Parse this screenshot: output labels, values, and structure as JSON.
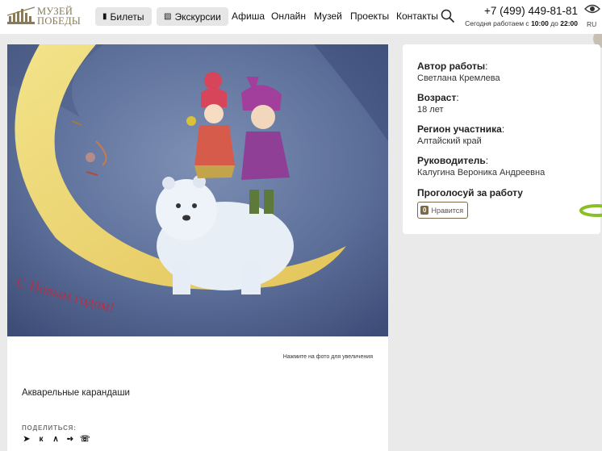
{
  "header": {
    "logo_line1": "МУЗЕЙ",
    "logo_line2": "ПОБЕДЫ",
    "tickets_label": "Билеты",
    "excursions_label": "Экскурсии",
    "nav": [
      "Афиша",
      "Онлайн",
      "Музей",
      "Проекты",
      "Контакты"
    ],
    "phone": "+7 (499) 449-81-81",
    "hours_prefix": "Сегодня работаем с",
    "hours_from": "10:00",
    "hours_mid": "до",
    "hours_to": "22:00",
    "lang": "RU"
  },
  "artwork": {
    "zoom_hint": "Нажмите на фото для увеличения",
    "technique": "Акварельные карандаши",
    "inscription": "С Новым годом!",
    "share_label": "ПОДЕЛИТЬСЯ:",
    "share_icons": [
      "share-icon",
      "vk-icon",
      "odnoklassniki-icon",
      "telegram-icon",
      "whatsapp-icon"
    ]
  },
  "info": {
    "author_label": "Автор работы",
    "author": "Светлана Кремлева",
    "age_label": "Возраст",
    "age": "18 лет",
    "region_label": "Регион участника",
    "region": "Алтайский край",
    "mentor_label": "Руководитель",
    "mentor": "Калугина Вероника Андреевна",
    "vote_label": "Проголосуй за работу",
    "likes": "0",
    "like_label": "Нравится"
  },
  "colors": {
    "accent": "#7b6a48",
    "background": "#eaeaea"
  }
}
